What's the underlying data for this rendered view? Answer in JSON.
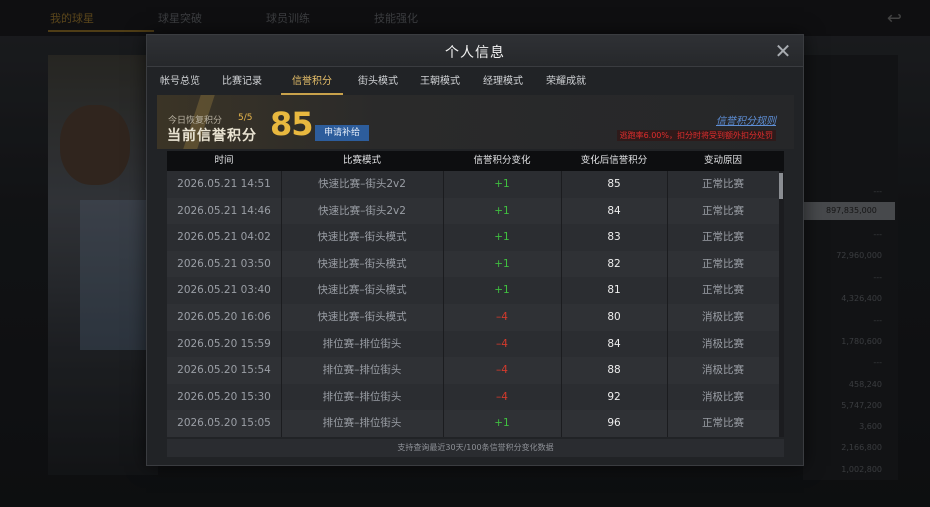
{
  "background": {
    "tabs": [
      "我的球星",
      "球星突破",
      "球员训练",
      "技能强化"
    ],
    "values": [
      "---",
      "897,835,000",
      "---",
      "72,960,000",
      "---",
      "4,326,400",
      "---",
      "1,780,600",
      "---",
      "458,240",
      "5,747,200",
      "3,600",
      "2,166,800",
      "1,002,800"
    ]
  },
  "modal": {
    "title": "个人信息",
    "tabs": [
      "帐号总览",
      "比赛记录",
      "信誉积分",
      "街头模式",
      "王朝模式",
      "经理模式",
      "荣耀成就"
    ],
    "active_tab": "信誉积分"
  },
  "credit": {
    "recover_label": "今日恢复积分",
    "recover_count": "5/5",
    "current_label": "当前信誉积分",
    "current_value": "85",
    "apply_button": "申请补给",
    "rule_link": "信誉积分规则",
    "penalty_note": "逃跑率6.00%，扣分时将受到额外扣分处罚"
  },
  "table": {
    "headers": [
      "时间",
      "比赛模式",
      "信誉积分变化",
      "变化后信誉积分",
      "变动原因"
    ],
    "rows": [
      {
        "time": "2026.05.21  14:51",
        "mode": "快速比赛–街头2v2",
        "change": "+1",
        "after": "85",
        "reason": "正常比赛"
      },
      {
        "time": "2026.05.21  14:46",
        "mode": "快速比赛–街头2v2",
        "change": "+1",
        "after": "84",
        "reason": "正常比赛"
      },
      {
        "time": "2026.05.21  04:02",
        "mode": "快速比赛–街头模式",
        "change": "+1",
        "after": "83",
        "reason": "正常比赛"
      },
      {
        "time": "2026.05.21  03:50",
        "mode": "快速比赛–街头模式",
        "change": "+1",
        "after": "82",
        "reason": "正常比赛"
      },
      {
        "time": "2026.05.21  03:40",
        "mode": "快速比赛–街头模式",
        "change": "+1",
        "after": "81",
        "reason": "正常比赛"
      },
      {
        "time": "2026.05.20  16:06",
        "mode": "快速比赛–街头模式",
        "change": "–4",
        "after": "80",
        "reason": "消极比赛"
      },
      {
        "time": "2026.05.20  15:59",
        "mode": "排位赛–排位街头",
        "change": "–4",
        "after": "84",
        "reason": "消极比赛"
      },
      {
        "time": "2026.05.20  15:54",
        "mode": "排位赛–排位街头",
        "change": "–4",
        "after": "88",
        "reason": "消极比赛"
      },
      {
        "time": "2026.05.20  15:30",
        "mode": "排位赛–排位街头",
        "change": "–4",
        "after": "92",
        "reason": "消极比赛"
      },
      {
        "time": "2026.05.20  15:05",
        "mode": "排位赛–排位街头",
        "change": "+1",
        "after": "96",
        "reason": "正常比赛"
      }
    ],
    "footer_note": "支持查询最近30天/100条信誉积分变化数据"
  },
  "colors": {
    "positive": "#3fbf3f",
    "negative": "#d63a2c",
    "accent_gold": "#e8b83f",
    "link_blue": "#5e8fd6"
  }
}
